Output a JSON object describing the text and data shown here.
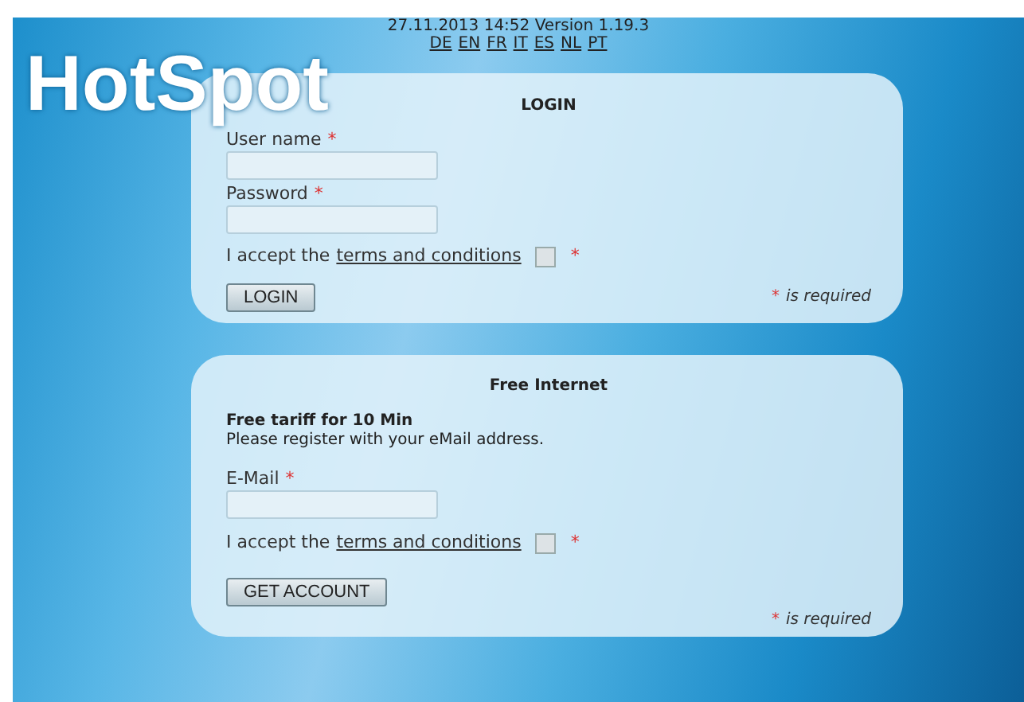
{
  "header": {
    "version": "27.11.2013 14:52 Version 1.19.3",
    "languages": [
      "DE",
      "EN",
      "FR",
      "IT",
      "ES",
      "NL",
      "PT"
    ]
  },
  "logo": "HotSpot",
  "login": {
    "title": "LOGIN",
    "fields": [
      {
        "label": "User name",
        "required_mark": "*"
      },
      {
        "label": "Password",
        "required_mark": "*"
      }
    ],
    "terms": {
      "prefix": "I accept the",
      "link": "terms and conditions",
      "checked": false,
      "required_mark": "*"
    },
    "button": "LOGIN",
    "required_note": {
      "mark": "*",
      "text": "is required"
    }
  },
  "register": {
    "title": "Free Internet",
    "tariff": "Free tariff for 10 Min",
    "instruction": "Please register with your eMail address.",
    "fields": [
      {
        "label": "E-Mail",
        "required_mark": "*"
      }
    ],
    "terms": {
      "prefix": "I accept the",
      "link": "terms and conditions",
      "checked": false,
      "required_mark": "*"
    },
    "button": "GET ACCOUNT",
    "required_note": {
      "mark": "*",
      "text": "is required"
    }
  }
}
